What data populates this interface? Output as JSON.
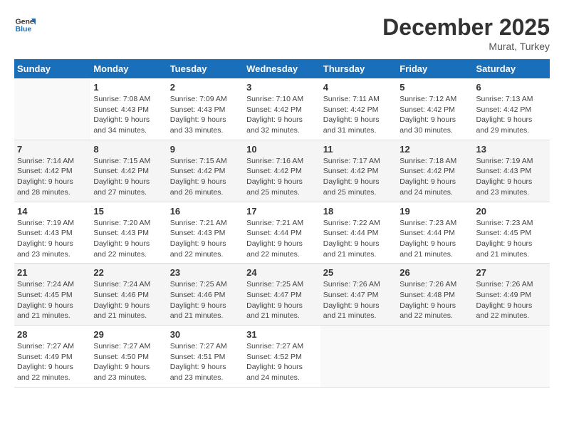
{
  "header": {
    "logo_general": "General",
    "logo_blue": "Blue",
    "month": "December 2025",
    "location": "Murat, Turkey"
  },
  "days_of_week": [
    "Sunday",
    "Monday",
    "Tuesday",
    "Wednesday",
    "Thursday",
    "Friday",
    "Saturday"
  ],
  "weeks": [
    [
      {
        "day": "",
        "info": ""
      },
      {
        "day": "1",
        "info": "Sunrise: 7:08 AM\nSunset: 4:43 PM\nDaylight: 9 hours\nand 34 minutes."
      },
      {
        "day": "2",
        "info": "Sunrise: 7:09 AM\nSunset: 4:43 PM\nDaylight: 9 hours\nand 33 minutes."
      },
      {
        "day": "3",
        "info": "Sunrise: 7:10 AM\nSunset: 4:42 PM\nDaylight: 9 hours\nand 32 minutes."
      },
      {
        "day": "4",
        "info": "Sunrise: 7:11 AM\nSunset: 4:42 PM\nDaylight: 9 hours\nand 31 minutes."
      },
      {
        "day": "5",
        "info": "Sunrise: 7:12 AM\nSunset: 4:42 PM\nDaylight: 9 hours\nand 30 minutes."
      },
      {
        "day": "6",
        "info": "Sunrise: 7:13 AM\nSunset: 4:42 PM\nDaylight: 9 hours\nand 29 minutes."
      }
    ],
    [
      {
        "day": "7",
        "info": "Sunrise: 7:14 AM\nSunset: 4:42 PM\nDaylight: 9 hours\nand 28 minutes."
      },
      {
        "day": "8",
        "info": "Sunrise: 7:15 AM\nSunset: 4:42 PM\nDaylight: 9 hours\nand 27 minutes."
      },
      {
        "day": "9",
        "info": "Sunrise: 7:15 AM\nSunset: 4:42 PM\nDaylight: 9 hours\nand 26 minutes."
      },
      {
        "day": "10",
        "info": "Sunrise: 7:16 AM\nSunset: 4:42 PM\nDaylight: 9 hours\nand 25 minutes."
      },
      {
        "day": "11",
        "info": "Sunrise: 7:17 AM\nSunset: 4:42 PM\nDaylight: 9 hours\nand 25 minutes."
      },
      {
        "day": "12",
        "info": "Sunrise: 7:18 AM\nSunset: 4:42 PM\nDaylight: 9 hours\nand 24 minutes."
      },
      {
        "day": "13",
        "info": "Sunrise: 7:19 AM\nSunset: 4:43 PM\nDaylight: 9 hours\nand 23 minutes."
      }
    ],
    [
      {
        "day": "14",
        "info": "Sunrise: 7:19 AM\nSunset: 4:43 PM\nDaylight: 9 hours\nand 23 minutes."
      },
      {
        "day": "15",
        "info": "Sunrise: 7:20 AM\nSunset: 4:43 PM\nDaylight: 9 hours\nand 22 minutes."
      },
      {
        "day": "16",
        "info": "Sunrise: 7:21 AM\nSunset: 4:43 PM\nDaylight: 9 hours\nand 22 minutes."
      },
      {
        "day": "17",
        "info": "Sunrise: 7:21 AM\nSunset: 4:44 PM\nDaylight: 9 hours\nand 22 minutes."
      },
      {
        "day": "18",
        "info": "Sunrise: 7:22 AM\nSunset: 4:44 PM\nDaylight: 9 hours\nand 21 minutes."
      },
      {
        "day": "19",
        "info": "Sunrise: 7:23 AM\nSunset: 4:44 PM\nDaylight: 9 hours\nand 21 minutes."
      },
      {
        "day": "20",
        "info": "Sunrise: 7:23 AM\nSunset: 4:45 PM\nDaylight: 9 hours\nand 21 minutes."
      }
    ],
    [
      {
        "day": "21",
        "info": "Sunrise: 7:24 AM\nSunset: 4:45 PM\nDaylight: 9 hours\nand 21 minutes."
      },
      {
        "day": "22",
        "info": "Sunrise: 7:24 AM\nSunset: 4:46 PM\nDaylight: 9 hours\nand 21 minutes."
      },
      {
        "day": "23",
        "info": "Sunrise: 7:25 AM\nSunset: 4:46 PM\nDaylight: 9 hours\nand 21 minutes."
      },
      {
        "day": "24",
        "info": "Sunrise: 7:25 AM\nSunset: 4:47 PM\nDaylight: 9 hours\nand 21 minutes."
      },
      {
        "day": "25",
        "info": "Sunrise: 7:26 AM\nSunset: 4:47 PM\nDaylight: 9 hours\nand 21 minutes."
      },
      {
        "day": "26",
        "info": "Sunrise: 7:26 AM\nSunset: 4:48 PM\nDaylight: 9 hours\nand 22 minutes."
      },
      {
        "day": "27",
        "info": "Sunrise: 7:26 AM\nSunset: 4:49 PM\nDaylight: 9 hours\nand 22 minutes."
      }
    ],
    [
      {
        "day": "28",
        "info": "Sunrise: 7:27 AM\nSunset: 4:49 PM\nDaylight: 9 hours\nand 22 minutes."
      },
      {
        "day": "29",
        "info": "Sunrise: 7:27 AM\nSunset: 4:50 PM\nDaylight: 9 hours\nand 23 minutes."
      },
      {
        "day": "30",
        "info": "Sunrise: 7:27 AM\nSunset: 4:51 PM\nDaylight: 9 hours\nand 23 minutes."
      },
      {
        "day": "31",
        "info": "Sunrise: 7:27 AM\nSunset: 4:52 PM\nDaylight: 9 hours\nand 24 minutes."
      },
      {
        "day": "",
        "info": ""
      },
      {
        "day": "",
        "info": ""
      },
      {
        "day": "",
        "info": ""
      }
    ]
  ]
}
